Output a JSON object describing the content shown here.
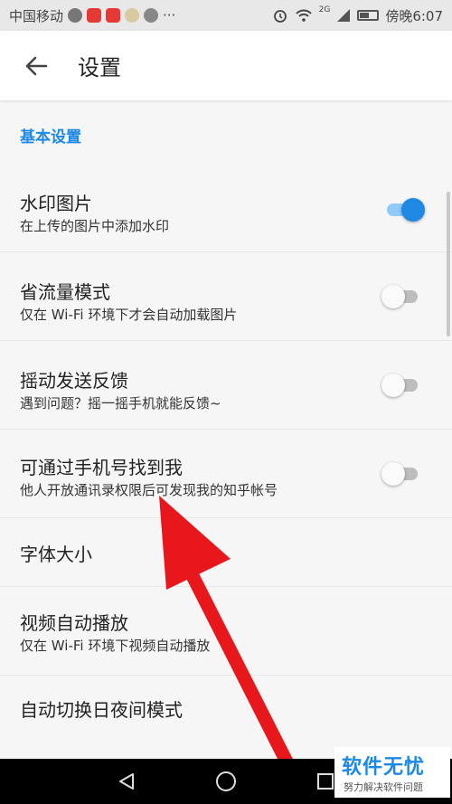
{
  "status_bar": {
    "carrier": "中国移动",
    "more": "···",
    "time_label": "傍晚6:07",
    "signal_badge": "2G",
    "icons": [
      "alarm-icon",
      "wifi-icon",
      "signal-icon",
      "battery-icon"
    ]
  },
  "app_bar": {
    "back_icon": "arrow-left-icon",
    "title": "设置"
  },
  "section": {
    "header": "基本设置"
  },
  "settings": [
    {
      "title": "水印图片",
      "subtitle": "在上传的图片中添加水印",
      "toggle": true
    },
    {
      "title": "省流量模式",
      "subtitle": "仅在 Wi-Fi 环境下才会自动加载图片",
      "toggle": false
    },
    {
      "title": "摇动发送反馈",
      "subtitle": "遇到问题？摇一摇手机就能反馈~",
      "toggle": false
    },
    {
      "title": "可通过手机号找到我",
      "subtitle": "他人开放通讯录权限后可发现我的知乎帐号",
      "toggle": false
    },
    {
      "title": "字体大小"
    },
    {
      "title": "视频自动播放",
      "subtitle": "仅在 Wi-Fi 环境下视频自动播放"
    },
    {
      "title": "自动切换日夜间模式"
    }
  ],
  "watermark": {
    "main": "软件无忧",
    "sub": "努力解决软件问题"
  },
  "nav_bar": {
    "icons": [
      "back-triangle-icon",
      "home-circle-icon",
      "recents-square-icon"
    ]
  },
  "colors": {
    "accent": "#1e88e5",
    "arrow": "#e8171b"
  }
}
